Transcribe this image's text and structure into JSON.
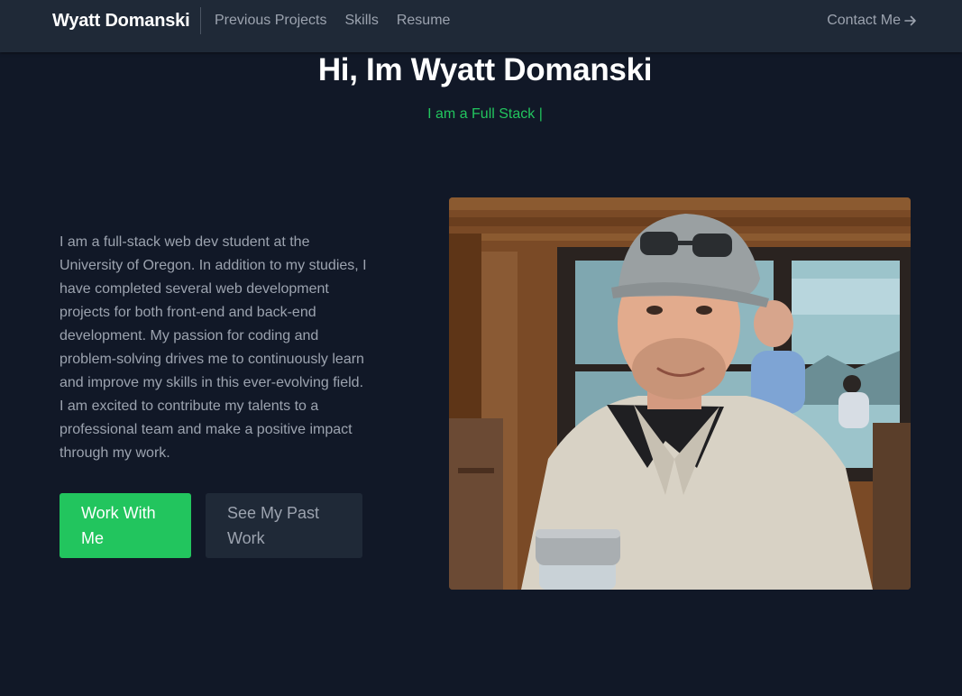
{
  "nav": {
    "brand": "Wyatt Domanski",
    "links": [
      "Previous Projects",
      "Skills",
      "Resume"
    ],
    "contact_label": "Contact Me",
    "contact_icon": "arrow-right-icon"
  },
  "hero": {
    "title": "Hi, Im Wyatt Domanski",
    "subtitle": "I am a Full Stack |",
    "bio": "I am a full-stack web dev student at the University of Oregon. In addition to my studies, I have completed several web development projects for both front-end and back-end development. My passion for coding and problem-solving drives me to continuously learn and improve my skills in this ever-evolving field. I am excited to contribute my talents to a professional team and make a positive impact through my work.",
    "primary_button": "Work With Me",
    "secondary_button": "See My Past Work"
  },
  "colors": {
    "background": "#111827",
    "navbar": "#1f2937",
    "accent": "#22c55e",
    "muted_text": "#9ca3af"
  }
}
